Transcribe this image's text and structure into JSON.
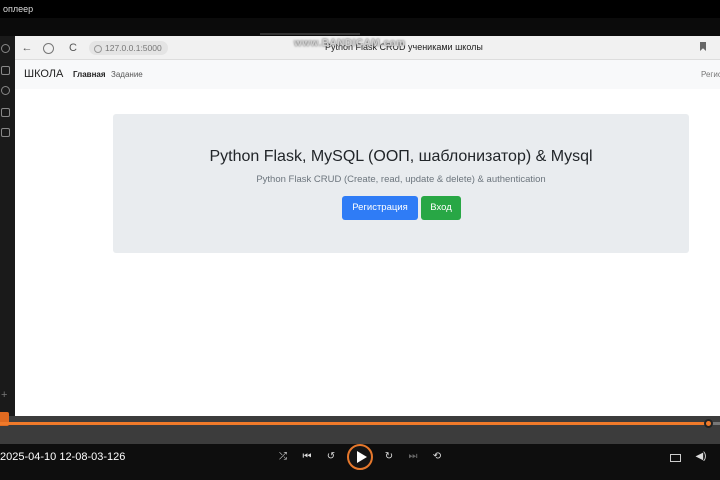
{
  "player": {
    "title": "оплеер",
    "timestamp_label": "2025-04-10 12-08-03-126",
    "progress_fraction": 0.98,
    "watermark": "www.BANDICAM.com",
    "icons": [
      "shuffle-icon",
      "previous-icon",
      "rewind-10-icon",
      "play-icon",
      "forward-30-icon",
      "next-icon",
      "repeat-off-icon",
      "subtitles-icon",
      "volume-icon"
    ],
    "accent_color": "#f07a2a"
  },
  "browser": {
    "back_icon": "←",
    "reload_icon": "C",
    "url": "127.0.0.1:5000",
    "tab_title": "Python Flask CRUD учениками школы"
  },
  "site": {
    "brand": "ШКОЛА",
    "nav": [
      "Главная",
      "Задание"
    ],
    "nav_right": "Регистр",
    "heading": "Python Flask, MySQL (ООП, шаблонизатор) & Mysql",
    "subheading": "Python Flask CRUD (Create, read, update & delete) & authentication",
    "register_button": "Регистрация",
    "login_button": "Вход",
    "primary_color": "#2f7cf6",
    "success_color": "#28a745"
  }
}
